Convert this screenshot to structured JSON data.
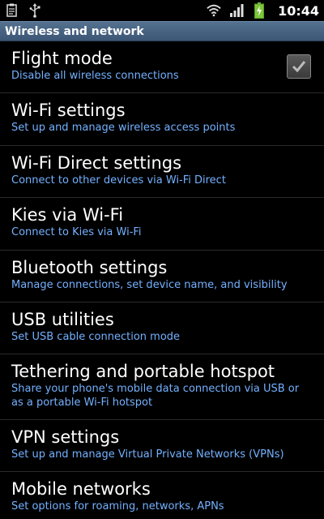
{
  "status_bar": {
    "time": "10:44",
    "left_icons": [
      "clipboard-icon",
      "usb-icon"
    ],
    "right_icons": [
      "wifi-icon",
      "signal-icon",
      "battery-charging-icon"
    ]
  },
  "section": {
    "title": "Wireless and network"
  },
  "items": [
    {
      "title": "Flight mode",
      "summary": "Disable all wireless connections",
      "checked": true
    },
    {
      "title": "Wi-Fi settings",
      "summary": "Set up and manage wireless access points"
    },
    {
      "title": "Wi-Fi Direct settings",
      "summary": "Connect to other devices via Wi-Fi Direct"
    },
    {
      "title": "Kies via Wi-Fi",
      "summary": "Connect to Kies via Wi-Fi"
    },
    {
      "title": "Bluetooth settings",
      "summary": "Manage connections, set device name, and visibility"
    },
    {
      "title": "USB utilities",
      "summary": "Set USB cable connection mode"
    },
    {
      "title": "Tethering and portable hotspot",
      "summary": "Share your phone's mobile data connection via USB or as a portable Wi-Fi hotspot"
    },
    {
      "title": "VPN settings",
      "summary": "Set up and manage Virtual Private Networks (VPNs)"
    },
    {
      "title": "Mobile networks",
      "summary": "Set options for roaming, networks, APNs"
    }
  ],
  "colors": {
    "summary_text": "#73b1ff",
    "header_bg": "#4a6585",
    "battery": "#7ec53a"
  }
}
